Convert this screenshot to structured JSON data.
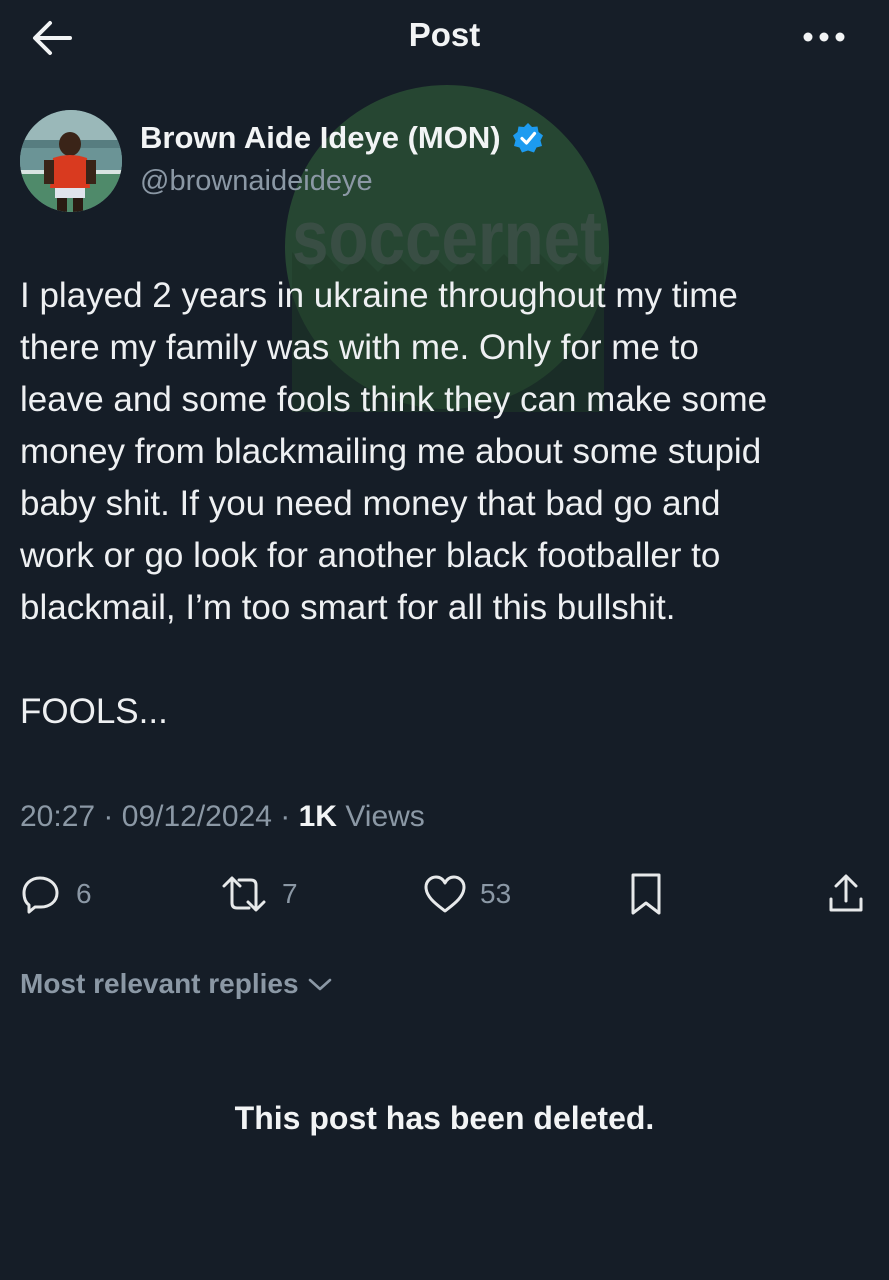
{
  "header": {
    "title": "Post",
    "back_icon": "arrow-left-icon",
    "more_icon": "more-dots-icon"
  },
  "watermark": {
    "text": "soccernet",
    "color": "#2e5a3a"
  },
  "author": {
    "display_name": "Brown Aide Ideye (MON)",
    "handle": "@brownaideideye",
    "verified": true,
    "verified_color": "#1d9bf0"
  },
  "post": {
    "lines": [
      "I played 2 years in ukraine throughout my time",
      "there my family was with me. Only for me to",
      "leave and some fools think they can make some",
      "money from blackmailing me about some stupid",
      "baby shit. If you need money that bad go and",
      "work or go look for another black footballer to",
      "blackmail, I’m too smart for all this bullshit."
    ],
    "closing": "FOOLS..."
  },
  "meta": {
    "time": "20:27",
    "separator": "·",
    "date": "09/12/2024",
    "views_count": "1K",
    "views_label": "Views"
  },
  "actions": {
    "replies": "6",
    "reposts": "7",
    "likes": "53"
  },
  "replies_filter": {
    "label": "Most relevant replies"
  },
  "notice": "This post has been deleted."
}
